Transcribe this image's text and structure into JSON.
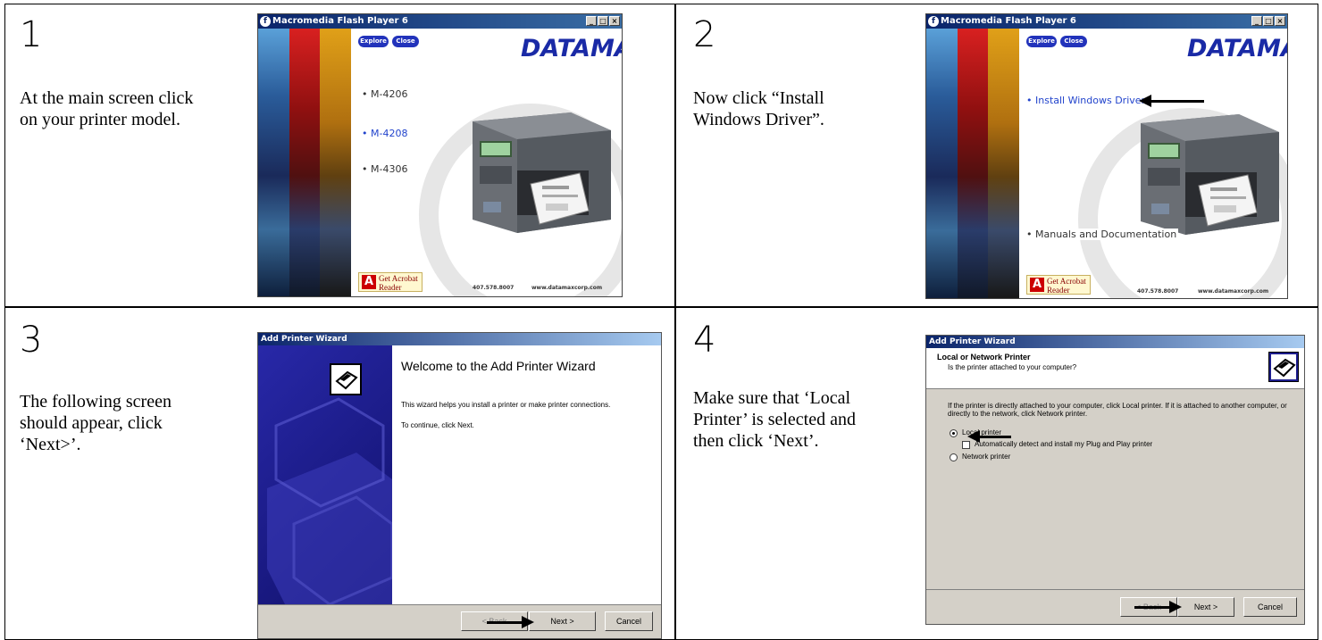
{
  "steps": [
    {
      "number": "1",
      "text_lines": [
        "At the main screen click",
        "on your printer model."
      ]
    },
    {
      "number": "2",
      "text_lines": [
        "Now click “Install",
        "Windows Driver”."
      ]
    },
    {
      "number": "3",
      "text_lines": [
        "The following screen",
        "should appear, click",
        "‘Next>’."
      ]
    },
    {
      "number": "4",
      "text_lines": [
        "Make sure that ‘Local",
        "Printer’ is selected and",
        "then click ‘Next’."
      ]
    }
  ],
  "flash": {
    "title": "Macromedia Flash Player 6",
    "explore": "Explore",
    "close": "Close",
    "brand": "DATAMAX",
    "reg": "®",
    "get": "Get",
    "acrobat_line1": "Acrobat",
    "acrobat_line2": "Reader",
    "adobe": "Adobe",
    "phone": "407.578.8007",
    "website": "www.datamaxcorp.com",
    "models": [
      "M-4206",
      "M-4208",
      "M-4306"
    ],
    "install_driver": "Install Windows Driver",
    "manuals": "Manuals and Documentation"
  },
  "wizard": {
    "title": "Add Printer Wizard",
    "welcome_title": "Welcome to the Add Printer Wizard",
    "welcome_text": "This wizard helps you install a printer or make printer connections.",
    "continue_text": "To continue, click Next.",
    "back": "< Back",
    "next": "Next >",
    "cancel": "Cancel",
    "section_title": "Local or Network Printer",
    "section_sub": "Is the printer attached to your computer?",
    "instructions": "If the printer is directly attached to your computer, click Local printer. If it is attached to another computer, or directly to the network, click Network printer.",
    "local": "Local printer",
    "auto_detect": "Automatically detect and install my Plug and Play printer",
    "network": "Network printer"
  },
  "colors": {
    "brand_blue": "#1a2aa6",
    "xp_title": "#0a246a",
    "wizard_panel": "#1c1c8c"
  }
}
